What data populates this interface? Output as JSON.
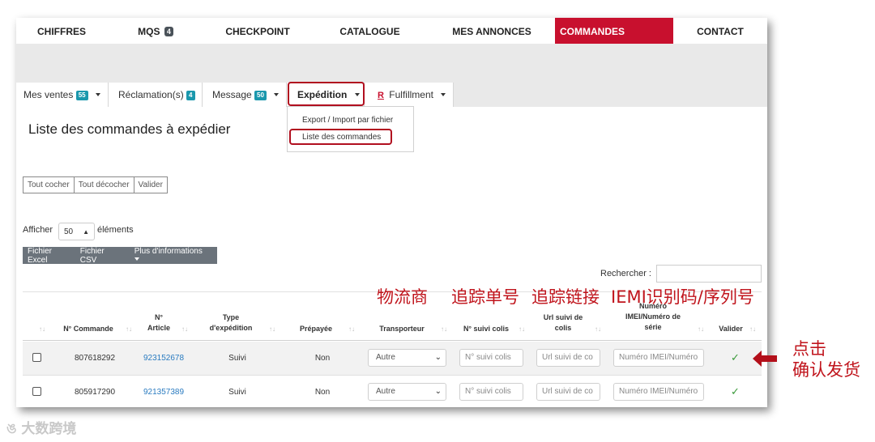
{
  "topnav": {
    "items": [
      "CHIFFRES",
      "MQS",
      "CHECKPOINT",
      "CATALOGUE",
      "MES ANNONCES",
      "COMMANDES",
      "CONTACT"
    ],
    "mqs_badge": "4"
  },
  "tabs": {
    "mes_ventes": "Mes ventes",
    "mes_ventes_badge": "55",
    "reclamations": "Réclamation(s)",
    "reclamations_badge": "4",
    "message": "Message",
    "message_badge": "50",
    "expedition": "Expédition",
    "fulfillment_icon": "R",
    "fulfillment": "Fulfillment"
  },
  "dropdown": {
    "items": [
      "Export / Import par fichier",
      "Liste des commandes"
    ]
  },
  "page_title": "Liste des commandes à expédier",
  "buttons": {
    "check_all": "Tout cocher",
    "uncheck_all": "Tout décocher",
    "validate": "Valider"
  },
  "length": {
    "prefix": "Afficher",
    "value": "50",
    "suffix": "éléments"
  },
  "export": {
    "excel": "Fichier Excel",
    "csv": "Fichier CSV",
    "more": "Plus d'informations"
  },
  "search": {
    "label": "Rechercher :"
  },
  "table": {
    "headers": {
      "commande": "N° Commande",
      "article_1": "N°",
      "article_2": "Article",
      "type_1": "Type",
      "type_2": "d'expédition",
      "prepayee": "Prépayée",
      "transporteur": "Transporteur",
      "suivi": "N° suivi colis",
      "url_1": "Url suivi de",
      "url_2": "colis",
      "imei_1": "Numéro",
      "imei_2": "IMEI/Numéro de",
      "imei_3": "série",
      "valider": "Valider"
    },
    "rows": [
      {
        "commande": "807618292",
        "article": "923152678",
        "type": "Suivi",
        "prepayee": "Non",
        "transporteur": "Autre"
      },
      {
        "commande": "805917290",
        "article": "921357389",
        "type": "Suivi",
        "prepayee": "Non",
        "transporteur": "Autre"
      }
    ],
    "placeholders": {
      "suivi": "N° suivi colis",
      "url": "Url suivi de co",
      "imei": "Numéro IMEI/Numéro"
    }
  },
  "annotations": {
    "carrier": "物流商",
    "tracking_no": "追踪单号",
    "tracking_link": "追踪链接",
    "imei": "IEMI识别码/序列号",
    "click_1": "点击",
    "click_2": "确认发货"
  },
  "watermark": "大数跨境",
  "colors": {
    "active_red": "#c8102e",
    "badge_teal": "#1b98ad",
    "annotation_red": "#c0141c"
  }
}
